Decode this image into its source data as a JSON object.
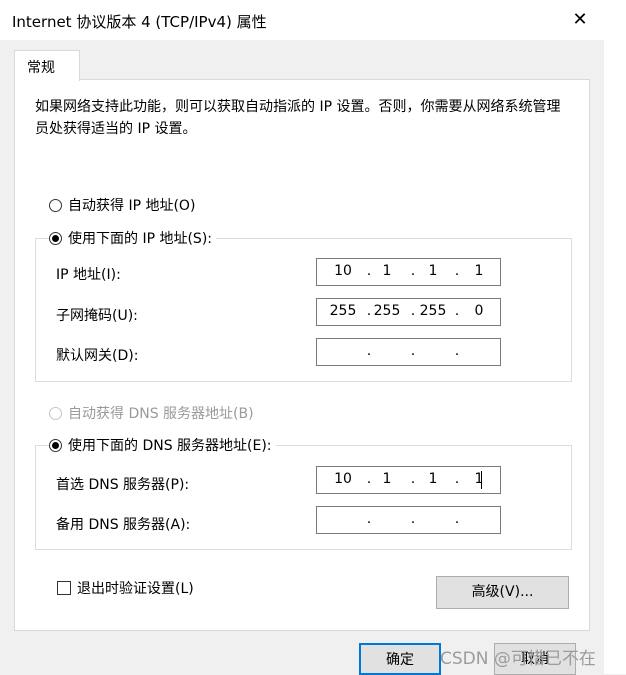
{
  "window": {
    "title": "Internet 协议版本 4 (TCP/IPv4) 属性",
    "close_glyph": "✕"
  },
  "tabs": [
    {
      "label": "常规"
    }
  ],
  "description": "如果网络支持此功能，则可以获取自动指派的 IP 设置。否则，你需要从网络系统管理员处获得适当的 IP 设置。",
  "ip_section": {
    "auto_radio": {
      "label": "自动获得 IP 地址(O)",
      "checked": false
    },
    "manual_radio": {
      "label": "使用下面的 IP 地址(S):",
      "checked": true
    },
    "fields": [
      {
        "label": "IP 地址(I):",
        "octets": [
          "10",
          "1",
          "1",
          "1"
        ]
      },
      {
        "label": "子网掩码(U):",
        "octets": [
          "255",
          "255",
          "255",
          "0"
        ]
      },
      {
        "label": "默认网关(D):",
        "octets": [
          "",
          "",
          "",
          ""
        ]
      }
    ]
  },
  "dns_section": {
    "auto_radio": {
      "label": "自动获得 DNS 服务器地址(B)",
      "checked": false,
      "disabled": true
    },
    "manual_radio": {
      "label": "使用下面的 DNS 服务器地址(E):",
      "checked": true
    },
    "fields": [
      {
        "label": "首选 DNS 服务器(P):",
        "octets": [
          "10",
          "1",
          "1",
          "1"
        ]
      },
      {
        "label": "备用 DNS 服务器(A):",
        "octets": [
          "",
          "",
          "",
          ""
        ]
      }
    ]
  },
  "validate_checkbox": {
    "label": "退出时验证设置(L)",
    "checked": false
  },
  "buttons": {
    "advanced": "高级(V)...",
    "ok": "确定",
    "cancel": "取消"
  },
  "watermark": "CSDN @可惜已不在",
  "accent_color": "#0078d7"
}
